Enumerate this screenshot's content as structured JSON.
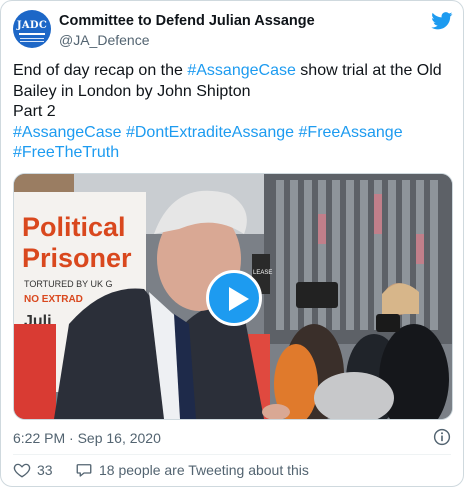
{
  "author": {
    "avatar_text": "JADC",
    "name": "Committee to Defend Julian Assange",
    "handle": "@JA_Defence"
  },
  "tweet": {
    "text_before": "End of day recap on the ",
    "hashtag_inline": "#AssangeCase",
    "text_after": " show trial at the Old Bailey in London by John Shipton",
    "line_part": "Part 2",
    "hashtags_line1": [
      "#AssangeCase",
      "#DontExtraditeAssange",
      "#FreeAssange"
    ],
    "hashtags_line2": [
      "#FreeTheTruth"
    ]
  },
  "media": {
    "sign_line1": "Political",
    "sign_line2": "Prisoner",
    "sign_line3": "TORTURED BY UK G",
    "sign_line4": "NO EXTRAD",
    "sign_line5": "Juli",
    "side_sign": "LEASE"
  },
  "meta": {
    "time": "6:22 PM · Sep 16, 2020"
  },
  "actions": {
    "like_count": "33",
    "reply_text": "18 people are Tweeting about this"
  },
  "colors": {
    "accent": "#1d9bf0",
    "text": "#0f1419",
    "secondary": "#536471",
    "like_red": "#f91880"
  },
  "icons": {
    "brand": "twitter-bird-icon",
    "play": "play-icon",
    "info": "info-icon",
    "like": "heart-icon",
    "reply": "speech-bubble-icon"
  }
}
